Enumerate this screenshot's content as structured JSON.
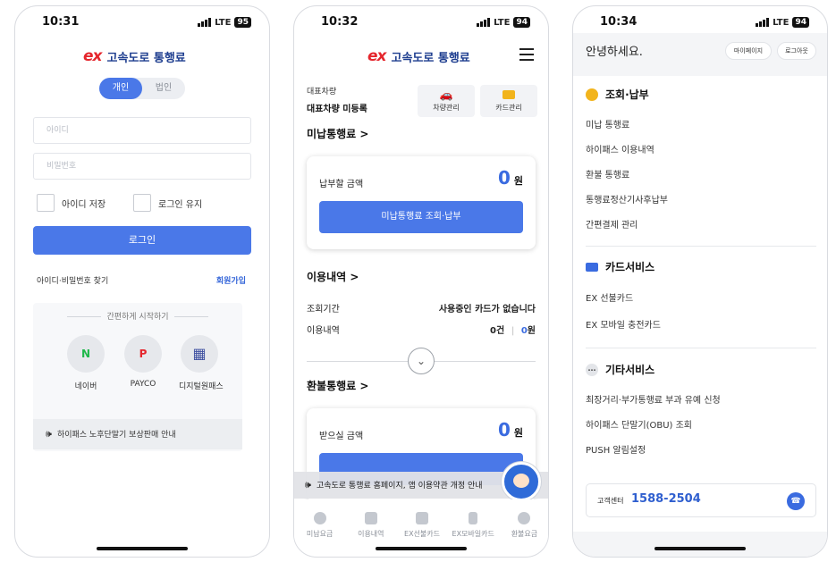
{
  "status": {
    "p1": {
      "time": "10:31",
      "net": "LTE",
      "battery": "95"
    },
    "p2": {
      "time": "10:32",
      "net": "LTE",
      "battery": "94"
    },
    "p3": {
      "time": "10:34",
      "net": "LTE",
      "battery": "94"
    }
  },
  "brand": {
    "ex": "ex",
    "name": "고속도로 통행료",
    "accent": "#4a78e8",
    "logo_red": "#e5262d"
  },
  "login": {
    "tab_personal": "개인",
    "tab_corp": "법인",
    "id_placeholder": "아이디",
    "pw_placeholder": "비밀번호",
    "save_id": "아이디 저장",
    "keep_login": "로그인 유지",
    "login_button": "로그인",
    "find": "아이디·비밀번호 찾기",
    "join": "회원가입",
    "easy_title": "간편하게 시작하기",
    "sns": [
      {
        "glyph": "N",
        "label": "네이버"
      },
      {
        "glyph": "P",
        "label": "PAYCO"
      },
      {
        "glyph": "▦",
        "label": "디지털원패스"
      }
    ],
    "notice": "하이패스 노후단말기 보상판매 안내"
  },
  "main": {
    "rep_label": "대표차량",
    "rep_value": "대표차량 미등록",
    "car_mgmt": "차량관리",
    "card_mgmt": "카드관리",
    "unpaid_title": "미납통행료 >",
    "pay_label": "납부할 금액",
    "pay_amount": "0",
    "won": "원",
    "unpaid_button": "미납통행료 조회·납부",
    "usage_title": "이용내역  >",
    "period_label": "조회기간",
    "period_value": "사용중인 카드가 없습니다",
    "usage_label": "이용내역",
    "usage_count": "0건",
    "usage_sep": "|",
    "usage_amount": "0",
    "refund_title": "환불통행료 >",
    "refund_label": "받으실 금액",
    "refund_amount": "0",
    "notice": "고속도로 통행료 홈페이지, 앱 이용약관 개정 안내",
    "tabs": [
      "미납요금",
      "이용내역",
      "EX선불카드",
      "EX모바일카드",
      "환불요금"
    ]
  },
  "menu": {
    "hello": "안녕하세요.",
    "mypage": "마이페이지",
    "logout": "로그아웃",
    "sections": [
      {
        "title": "조회·납부",
        "items": [
          "미납 통행료",
          "하이패스 이용내역",
          "환불 통행료",
          "통행료정산기사후납부",
          "간편결제 관리"
        ]
      },
      {
        "title": "카드서비스",
        "items": [
          "EX 선불카드",
          "EX 모바일 충전카드"
        ]
      },
      {
        "title": "기타서비스",
        "items": [
          "최장거리·부가통행료 부과 유예 신청",
          "하이패스 단말기(OBU) 조회",
          "PUSH 알림설정"
        ]
      }
    ],
    "cs_label": "고객센터",
    "cs_number": "1588-2504"
  }
}
